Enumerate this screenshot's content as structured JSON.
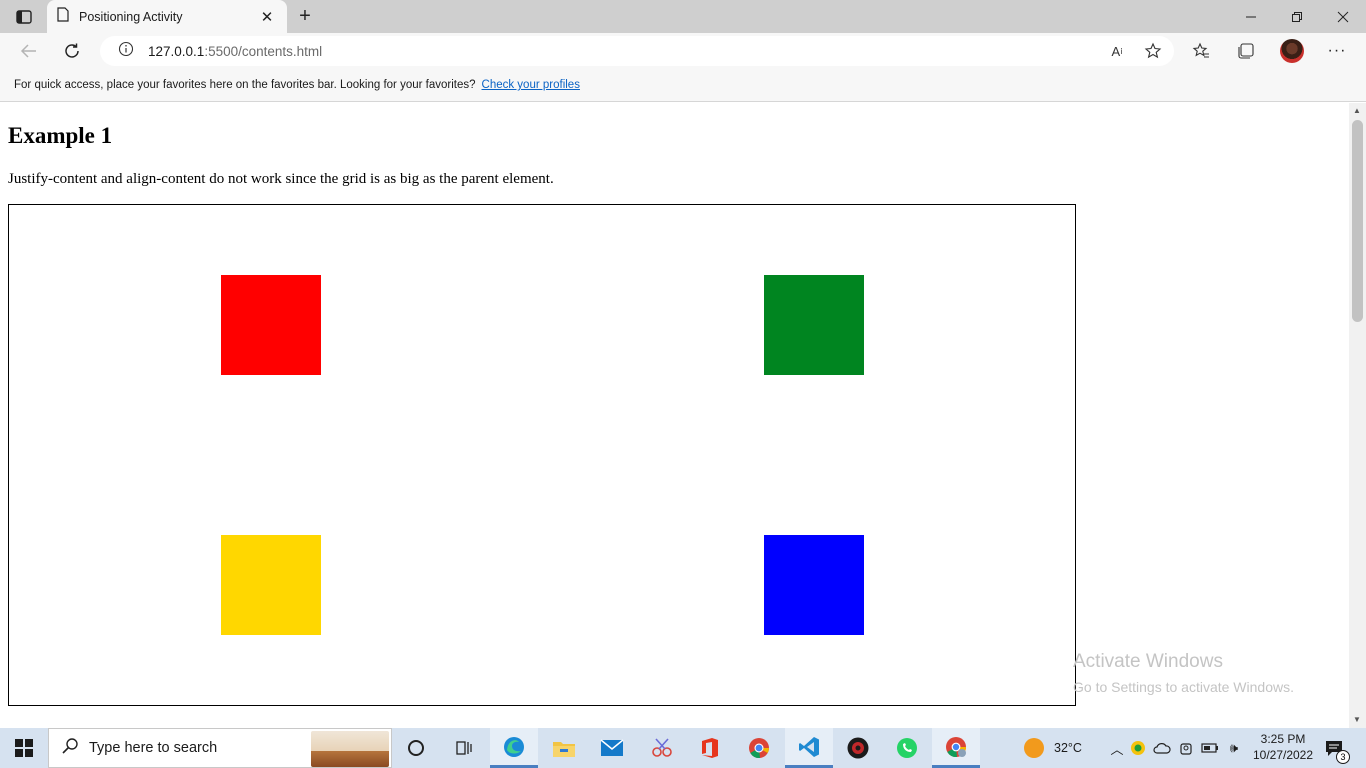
{
  "browser": {
    "tab_title": "Positioning Activity",
    "url_host": "127.0.0.1",
    "url_rest": ":5500/contents.html",
    "favbar_message": "For quick access, place your favorites here on the favorites bar. Looking for your favorites?",
    "favbar_link": "Check your profiles"
  },
  "page": {
    "heading": "Example 1",
    "description": "Justify-content and align-content do not work since the grid is as big as the parent element.",
    "squares": [
      {
        "color": "#ff0000"
      },
      {
        "color": "#008520"
      },
      {
        "color": "#ffd700"
      },
      {
        "color": "#0000ff"
      }
    ]
  },
  "watermark": {
    "title": "Activate Windows",
    "subtitle": "Go to Settings to activate Windows."
  },
  "taskbar": {
    "search_placeholder": "Type here to search",
    "weather": "32°C",
    "time": "3:25 PM",
    "date": "10/27/2022",
    "notification_count": "3"
  }
}
